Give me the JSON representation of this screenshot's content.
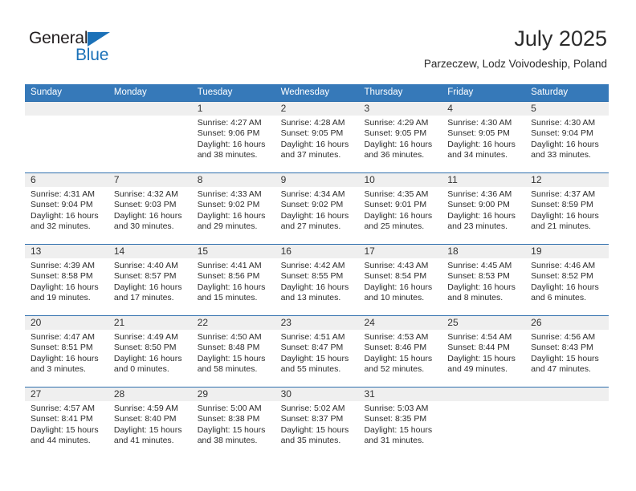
{
  "brand": {
    "line1": "General",
    "line2": "Blue",
    "triangle_icon": "triangle-icon",
    "accent_color": "#1b71b8"
  },
  "header": {
    "title": "July 2025",
    "subtitle": "Parzeczew, Lodz Voivodeship, Poland"
  },
  "calendar": {
    "header_bg": "#3679b9",
    "day_band_bg": "#efefef",
    "row_border_color": "#2f6fad",
    "weekdays": [
      "Sunday",
      "Monday",
      "Tuesday",
      "Wednesday",
      "Thursday",
      "Friday",
      "Saturday"
    ],
    "weeks": [
      [
        {
          "day": "",
          "lines": []
        },
        {
          "day": "",
          "lines": []
        },
        {
          "day": "1",
          "lines": [
            "Sunrise: 4:27 AM",
            "Sunset: 9:06 PM",
            "Daylight: 16 hours and 38 minutes."
          ]
        },
        {
          "day": "2",
          "lines": [
            "Sunrise: 4:28 AM",
            "Sunset: 9:05 PM",
            "Daylight: 16 hours and 37 minutes."
          ]
        },
        {
          "day": "3",
          "lines": [
            "Sunrise: 4:29 AM",
            "Sunset: 9:05 PM",
            "Daylight: 16 hours and 36 minutes."
          ]
        },
        {
          "day": "4",
          "lines": [
            "Sunrise: 4:30 AM",
            "Sunset: 9:05 PM",
            "Daylight: 16 hours and 34 minutes."
          ]
        },
        {
          "day": "5",
          "lines": [
            "Sunrise: 4:30 AM",
            "Sunset: 9:04 PM",
            "Daylight: 16 hours and 33 minutes."
          ]
        }
      ],
      [
        {
          "day": "6",
          "lines": [
            "Sunrise: 4:31 AM",
            "Sunset: 9:04 PM",
            "Daylight: 16 hours and 32 minutes."
          ]
        },
        {
          "day": "7",
          "lines": [
            "Sunrise: 4:32 AM",
            "Sunset: 9:03 PM",
            "Daylight: 16 hours and 30 minutes."
          ]
        },
        {
          "day": "8",
          "lines": [
            "Sunrise: 4:33 AM",
            "Sunset: 9:02 PM",
            "Daylight: 16 hours and 29 minutes."
          ]
        },
        {
          "day": "9",
          "lines": [
            "Sunrise: 4:34 AM",
            "Sunset: 9:02 PM",
            "Daylight: 16 hours and 27 minutes."
          ]
        },
        {
          "day": "10",
          "lines": [
            "Sunrise: 4:35 AM",
            "Sunset: 9:01 PM",
            "Daylight: 16 hours and 25 minutes."
          ]
        },
        {
          "day": "11",
          "lines": [
            "Sunrise: 4:36 AM",
            "Sunset: 9:00 PM",
            "Daylight: 16 hours and 23 minutes."
          ]
        },
        {
          "day": "12",
          "lines": [
            "Sunrise: 4:37 AM",
            "Sunset: 8:59 PM",
            "Daylight: 16 hours and 21 minutes."
          ]
        }
      ],
      [
        {
          "day": "13",
          "lines": [
            "Sunrise: 4:39 AM",
            "Sunset: 8:58 PM",
            "Daylight: 16 hours and 19 minutes."
          ]
        },
        {
          "day": "14",
          "lines": [
            "Sunrise: 4:40 AM",
            "Sunset: 8:57 PM",
            "Daylight: 16 hours and 17 minutes."
          ]
        },
        {
          "day": "15",
          "lines": [
            "Sunrise: 4:41 AM",
            "Sunset: 8:56 PM",
            "Daylight: 16 hours and 15 minutes."
          ]
        },
        {
          "day": "16",
          "lines": [
            "Sunrise: 4:42 AM",
            "Sunset: 8:55 PM",
            "Daylight: 16 hours and 13 minutes."
          ]
        },
        {
          "day": "17",
          "lines": [
            "Sunrise: 4:43 AM",
            "Sunset: 8:54 PM",
            "Daylight: 16 hours and 10 minutes."
          ]
        },
        {
          "day": "18",
          "lines": [
            "Sunrise: 4:45 AM",
            "Sunset: 8:53 PM",
            "Daylight: 16 hours and 8 minutes."
          ]
        },
        {
          "day": "19",
          "lines": [
            "Sunrise: 4:46 AM",
            "Sunset: 8:52 PM",
            "Daylight: 16 hours and 6 minutes."
          ]
        }
      ],
      [
        {
          "day": "20",
          "lines": [
            "Sunrise: 4:47 AM",
            "Sunset: 8:51 PM",
            "Daylight: 16 hours and 3 minutes."
          ]
        },
        {
          "day": "21",
          "lines": [
            "Sunrise: 4:49 AM",
            "Sunset: 8:50 PM",
            "Daylight: 16 hours and 0 minutes."
          ]
        },
        {
          "day": "22",
          "lines": [
            "Sunrise: 4:50 AM",
            "Sunset: 8:48 PM",
            "Daylight: 15 hours and 58 minutes."
          ]
        },
        {
          "day": "23",
          "lines": [
            "Sunrise: 4:51 AM",
            "Sunset: 8:47 PM",
            "Daylight: 15 hours and 55 minutes."
          ]
        },
        {
          "day": "24",
          "lines": [
            "Sunrise: 4:53 AM",
            "Sunset: 8:46 PM",
            "Daylight: 15 hours and 52 minutes."
          ]
        },
        {
          "day": "25",
          "lines": [
            "Sunrise: 4:54 AM",
            "Sunset: 8:44 PM",
            "Daylight: 15 hours and 49 minutes."
          ]
        },
        {
          "day": "26",
          "lines": [
            "Sunrise: 4:56 AM",
            "Sunset: 8:43 PM",
            "Daylight: 15 hours and 47 minutes."
          ]
        }
      ],
      [
        {
          "day": "27",
          "lines": [
            "Sunrise: 4:57 AM",
            "Sunset: 8:41 PM",
            "Daylight: 15 hours and 44 minutes."
          ]
        },
        {
          "day": "28",
          "lines": [
            "Sunrise: 4:59 AM",
            "Sunset: 8:40 PM",
            "Daylight: 15 hours and 41 minutes."
          ]
        },
        {
          "day": "29",
          "lines": [
            "Sunrise: 5:00 AM",
            "Sunset: 8:38 PM",
            "Daylight: 15 hours and 38 minutes."
          ]
        },
        {
          "day": "30",
          "lines": [
            "Sunrise: 5:02 AM",
            "Sunset: 8:37 PM",
            "Daylight: 15 hours and 35 minutes."
          ]
        },
        {
          "day": "31",
          "lines": [
            "Sunrise: 5:03 AM",
            "Sunset: 8:35 PM",
            "Daylight: 15 hours and 31 minutes."
          ]
        },
        {
          "day": "",
          "lines": []
        },
        {
          "day": "",
          "lines": []
        }
      ]
    ]
  }
}
